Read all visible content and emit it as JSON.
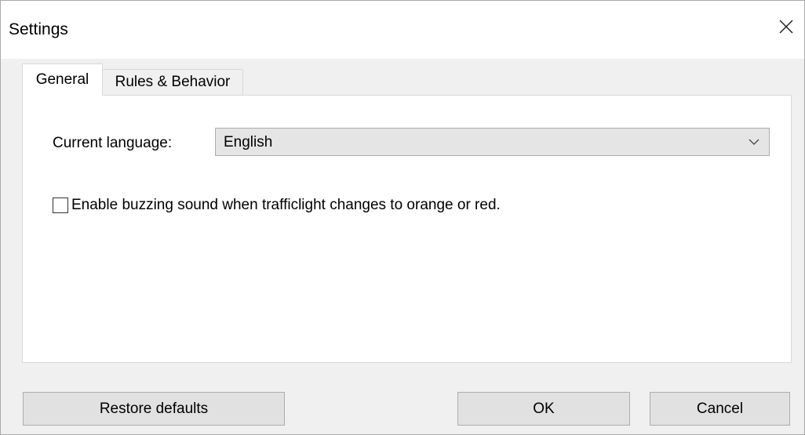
{
  "window": {
    "title": "Settings"
  },
  "tabs": [
    {
      "label": "General",
      "selected": true
    },
    {
      "label": "Rules & Behavior",
      "selected": false
    }
  ],
  "general": {
    "language_label": "Current language:",
    "language_value": "English",
    "buzz_checkbox": {
      "label": "Enable buzzing sound when trafficlight changes to orange or red.",
      "checked": false
    }
  },
  "buttons": {
    "restore": "Restore defaults",
    "ok": "OK",
    "cancel": "Cancel"
  },
  "icons": {
    "close": "close-icon",
    "dropdown": "chevron-down-icon"
  },
  "colors": {
    "window_bg": "#f0f0f0",
    "panel_bg": "#ffffff",
    "button_bg": "#e1e1e1",
    "select_bg": "#e5e5e5"
  }
}
